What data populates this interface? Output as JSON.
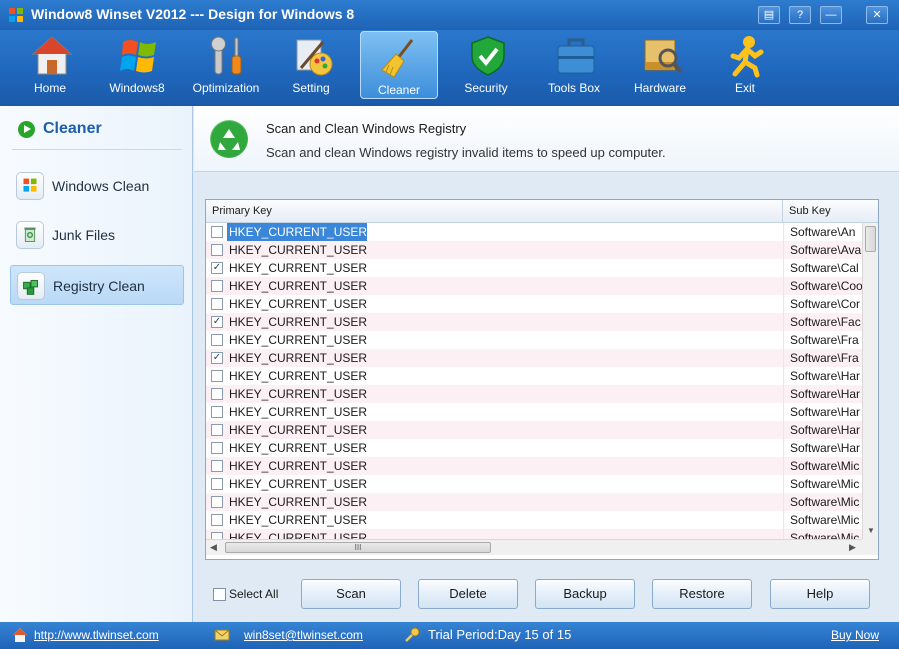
{
  "window": {
    "title": "Window8 Winset V2012 --- Design for Windows 8",
    "controls": [
      "▤",
      "?",
      "—",
      "✕"
    ]
  },
  "toolbar": {
    "items": [
      {
        "label": "Home",
        "icon": "home-icon"
      },
      {
        "label": "Windows8",
        "icon": "windows-logo-icon"
      },
      {
        "label": "Optimization",
        "icon": "tools-icon"
      },
      {
        "label": "Setting",
        "icon": "paint-brush-icon"
      },
      {
        "label": "Cleaner",
        "icon": "broom-icon",
        "active": true
      },
      {
        "label": "Security",
        "icon": "shield-check-icon"
      },
      {
        "label": "Tools Box",
        "icon": "toolbox-icon"
      },
      {
        "label": "Hardware",
        "icon": "hard-drive-icon"
      },
      {
        "label": "Exit",
        "icon": "running-man-icon"
      }
    ]
  },
  "sidebar": {
    "title": "Cleaner",
    "items": [
      {
        "label": "Windows Clean",
        "icon": "windows-logo-icon"
      },
      {
        "label": "Junk Files",
        "icon": "recycle-bin-icon"
      },
      {
        "label": "Registry Clean",
        "icon": "registry-cubes-icon",
        "active": true
      }
    ]
  },
  "main": {
    "title": "Scan and Clean Windows Registry",
    "description": "Scan and clean Windows registry invalid items to speed up computer."
  },
  "grid": {
    "columns": [
      "Primary Key",
      "Sub Key"
    ],
    "rows": [
      {
        "primary": "HKEY_CURRENT_USER",
        "sub": "Software\\An",
        "checked": false,
        "selected": true
      },
      {
        "primary": "HKEY_CURRENT_USER",
        "sub": "Software\\Ava",
        "checked": false
      },
      {
        "primary": "HKEY_CURRENT_USER",
        "sub": "Software\\Cal",
        "checked": true
      },
      {
        "primary": "HKEY_CURRENT_USER",
        "sub": "Software\\Coo",
        "checked": false
      },
      {
        "primary": "HKEY_CURRENT_USER",
        "sub": "Software\\Cor",
        "checked": false
      },
      {
        "primary": "HKEY_CURRENT_USER",
        "sub": "Software\\Fac",
        "checked": true
      },
      {
        "primary": "HKEY_CURRENT_USER",
        "sub": "Software\\Fra",
        "checked": false
      },
      {
        "primary": "HKEY_CURRENT_USER",
        "sub": "Software\\Fra",
        "checked": true
      },
      {
        "primary": "HKEY_CURRENT_USER",
        "sub": "Software\\Har",
        "checked": false
      },
      {
        "primary": "HKEY_CURRENT_USER",
        "sub": "Software\\Har",
        "checked": false
      },
      {
        "primary": "HKEY_CURRENT_USER",
        "sub": "Software\\Har",
        "checked": false
      },
      {
        "primary": "HKEY_CURRENT_USER",
        "sub": "Software\\Har",
        "checked": false
      },
      {
        "primary": "HKEY_CURRENT_USER",
        "sub": "Software\\Har",
        "checked": false
      },
      {
        "primary": "HKEY_CURRENT_USER",
        "sub": "Software\\Mic",
        "checked": false
      },
      {
        "primary": "HKEY_CURRENT_USER",
        "sub": "Software\\Mic",
        "checked": false
      },
      {
        "primary": "HKEY_CURRENT_USER",
        "sub": "Software\\Mic",
        "checked": false
      },
      {
        "primary": "HKEY_CURRENT_USER",
        "sub": "Software\\Mic",
        "checked": false
      },
      {
        "primary": "HKEY_CURRENT_USER",
        "sub": "Software\\Mic",
        "checked": false
      }
    ],
    "hscroll_grip": "III"
  },
  "actions": {
    "select_all": "Select All",
    "buttons": [
      "Scan",
      "Delete",
      "Backup",
      "Restore",
      "Help"
    ]
  },
  "status": {
    "website": "http://www.tlwinset.com",
    "email": "win8set@tlwinset.com",
    "trial": "Trial Period:Day 15 of 15",
    "buy": "Buy Now"
  }
}
